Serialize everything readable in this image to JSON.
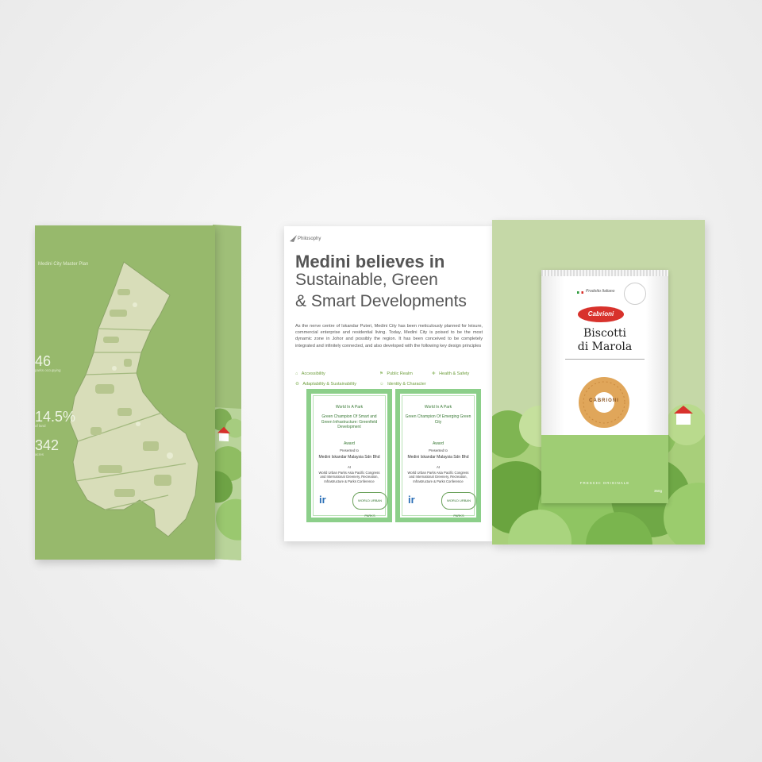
{
  "left_brochure": {
    "title": "Medini City Master Plan",
    "stats": [
      {
        "value": "46",
        "label": "parks occupying"
      },
      {
        "value": "14.5%",
        "label": "of land"
      },
      {
        "value": "342",
        "label": "acres"
      }
    ]
  },
  "right_brochure": {
    "section": "Philosophy",
    "heading_line1": "Medini believes in",
    "heading_line2": "Sustainable, Green",
    "heading_line3": "& Smart Developments",
    "body": "As the nerve centre of Iskandar Puteri, Medini City has been meticulously planned for leisure, commercial enterprise and residential living. Today, Medini City is poised to be the most dynamic zone in Johor and possibly the region. It has been conceived to be completely integrated and infinitely connected, and also developed with the following key design principles",
    "principles": [
      "Accessibility",
      "Public Realm",
      "Health & Safety",
      "Adaptability & Sustainability",
      "Identity & Character"
    ],
    "certificates": [
      {
        "event": "World In A Park",
        "title": "Green Champion Of Smart and Green Infrastructure: Greenfield Development",
        "award": "Award",
        "presented": "Presented to",
        "recipient": "Medini Iskandar Malaysia Sdn Bhd",
        "at": "At",
        "conference": "World Urban Parks Asia Pacific Congress and International Greenery, Recreation, Infrastructure & Parks Conference"
      },
      {
        "event": "World In A Park",
        "title": "Green Champion Of Emerging Green City",
        "award": "Award",
        "presented": "Presented to",
        "recipient": "Medini Iskandar Malaysia Sdn Bhd",
        "at": "At",
        "conference": "World Urban Parks Asia Pacific Congress and International Greenery, Recreation, Infrastructure & Parks Conference"
      }
    ],
    "cert_logo_text": "WORLD URBAN PARKS"
  },
  "package": {
    "tag": "Prodotto Italiano",
    "brand": "Cabrioni",
    "product_line1": "Biscotti",
    "product_line2": "di Marola",
    "biscuit_text": "CABRIONI",
    "footer": "FRESCHI ORIGINALE",
    "weight": "350g"
  },
  "colors": {
    "folder_green": "#97b96c",
    "accent_green": "#6d9d3c",
    "cert_border": "#8ccf8a",
    "brand_red": "#d8322c"
  }
}
